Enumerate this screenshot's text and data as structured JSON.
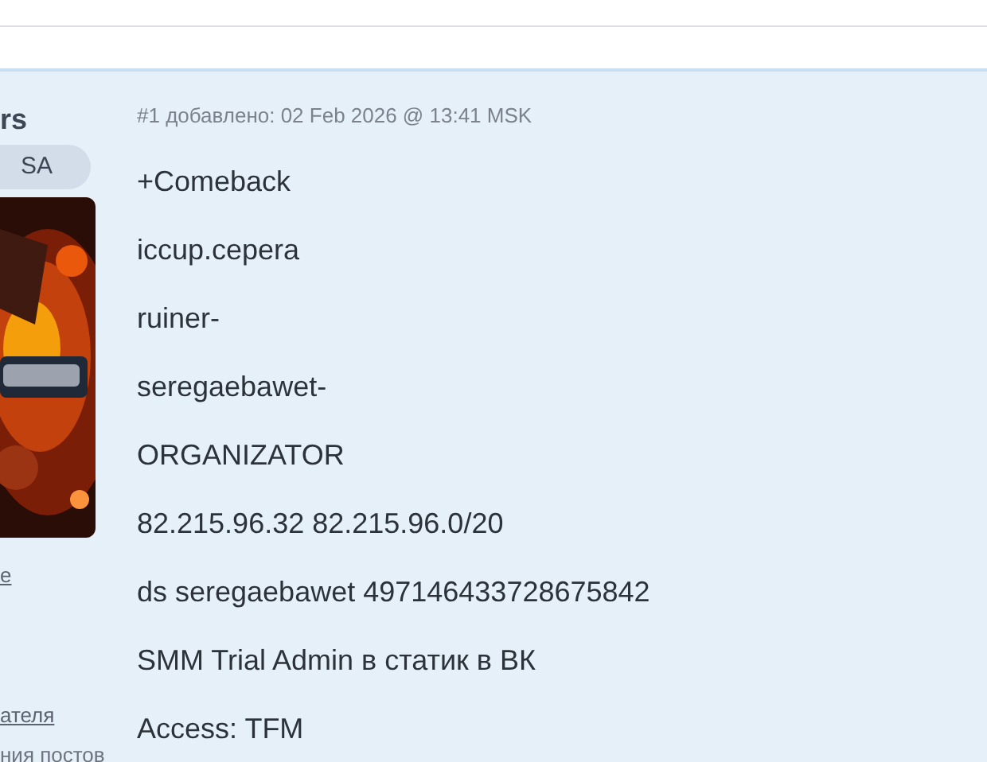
{
  "author": {
    "name": "rs",
    "badge": "SA",
    "links": [
      "e",
      "ателя"
    ],
    "stat": "ния постов"
  },
  "post": {
    "header": "#1 добавлено: 02 Feb 2026 @ 13:41 MSK",
    "lines": [
      "+Comeback",
      "iccup.cepera",
      "ruiner-",
      "seregaebawet-",
      "ORGANIZATOR",
      "82.215.96.32 82.215.96.0/20",
      "ds seregaebawet 497146433728675842",
      "SMM Trial Admin в статик в ВК",
      "Access: TFM"
    ]
  }
}
